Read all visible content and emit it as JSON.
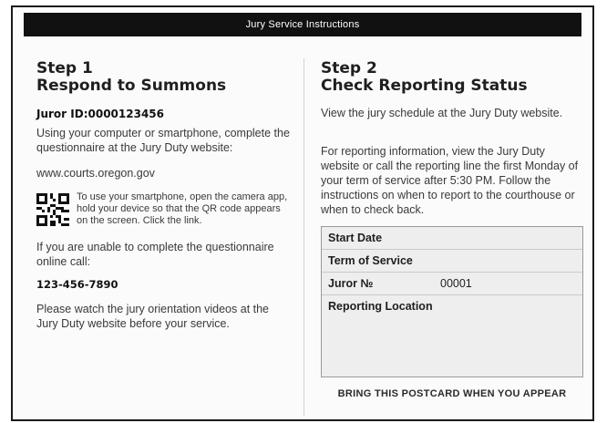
{
  "banner": {
    "title": "Jury Service Instructions"
  },
  "step1": {
    "label": "Step 1",
    "title": "Respond to Summons",
    "juror_id": "Juror ID:0000123456",
    "instructions": "Using your computer or smartphone, complete the questionnaire at the Jury Duty website:",
    "url": "www.courts.oregon.gov",
    "qr_text": "To use your smartphone, open the camera app, hold your device so that the QR code appears on the screen. Click the link.",
    "unable_text": "If you are unable to complete the questionnaire online call:",
    "phone": "123-456-7890",
    "video_text": "Please watch the jury orientation videos at the Jury Duty website before your service."
  },
  "step2": {
    "label": "Step 2",
    "title": "Check Reporting Status",
    "schedule_text": "View the jury schedule at the Jury Duty website.",
    "reporting_text": "For reporting information, view the Jury Duty website or call the reporting line the first Monday of your term of service after 5:30 PM. Follow the instructions on when to report to the courthouse or when to check back.",
    "fields": {
      "start_date": "Start Date",
      "term": "Term of Service",
      "juror_no_label": "Juror №",
      "juror_no_value": "00001",
      "location": "Reporting Location"
    },
    "footer": "BRING THIS POSTCARD WHEN YOU APPEAR"
  }
}
